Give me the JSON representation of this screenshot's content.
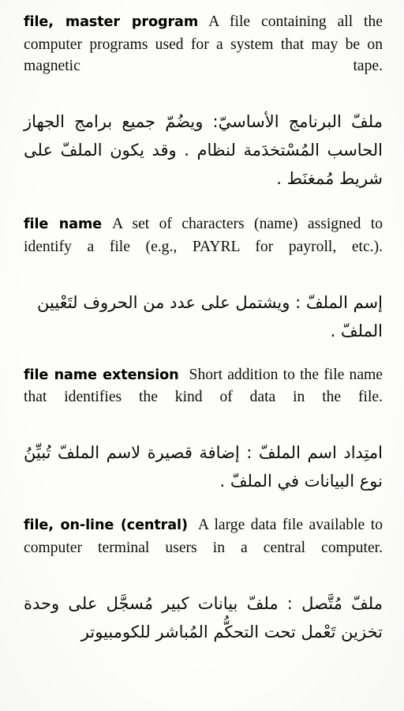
{
  "page": {
    "type": "scanned-dictionary-page",
    "language_pair": "English–Arabic",
    "background_color": "#fdfdfc",
    "text_color": "#0d0d0d"
  },
  "entries": [
    {
      "headword": "file, master program",
      "definition_en": "A file containing all the computer programs used for a system that may be on magnetic tape.",
      "definition_ar": "ملفّ البرنامج الأساسيّ: ويضُمّ جميع برامج الجهاز الحاسب المُسْتخدَمة لنظام . وقد يكون الملفّ على شريط مُمغنَط ."
    },
    {
      "headword": "file name",
      "definition_en": "A set of characters (name) assigned to identify a file (e.g., PAYRL for payroll, etc.).",
      "definition_ar": "إسم الملفّ : ويشتمل على عدد من الحروف لتَعْيين الملفّ ."
    },
    {
      "headword": "file name extension",
      "definition_en": "Short addition to the file name that identifies the kind of data in the file.",
      "definition_ar": "امتِداد اسم الملفّ : إضافة قصيرة لاسم الملفّ تُبيِّنُ نوع البيانات في الملفّ ."
    },
    {
      "headword": "file, on-line (central)",
      "definition_en": "A large data file available to computer terminal users in a central computer.",
      "definition_ar": "ملفّ مُتَّصل : ملفّ بيانات كبير مُسجَّل على وحدة تخزين تَعْمل تحت التحكُّم المُباشر للكومبيوتر"
    }
  ]
}
